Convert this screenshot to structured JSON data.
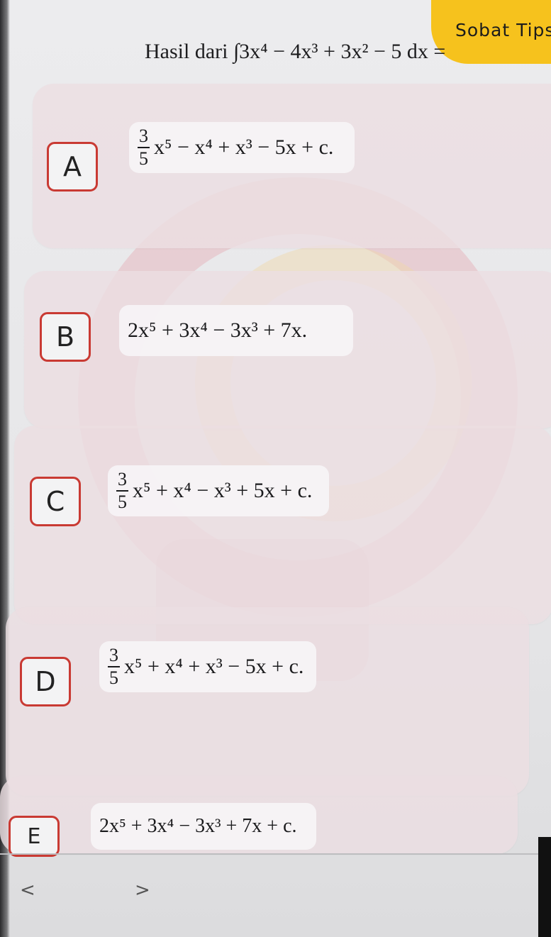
{
  "badge": {
    "label": "Sobat Tips"
  },
  "question": {
    "text": "Hasil dari ∫3x⁴ − 4x³ + 3x² − 5 dx ="
  },
  "options": [
    {
      "letter": "A",
      "num": "3",
      "den": "5",
      "rest": "x⁵ − x⁴ + x³ − 5x + c."
    },
    {
      "letter": "B",
      "text": "2x⁵ + 3x⁴ − 3x³ + 7x."
    },
    {
      "letter": "C",
      "num": "3",
      "den": "5",
      "rest": "x⁵ + x⁴ − x³ + 5x + c."
    },
    {
      "letter": "D",
      "num": "3",
      "den": "5",
      "rest": "x⁵ + x⁴ + x³ − 5x + c."
    },
    {
      "letter": "E",
      "text": "2x⁵ + 3x⁴ − 3x³ + 7x + c."
    }
  ],
  "nav": {
    "prev": "<",
    "next": ">"
  },
  "colors": {
    "badge": "#f6c21d",
    "letter_border": "#c93a33",
    "card": "#ecdee2"
  }
}
